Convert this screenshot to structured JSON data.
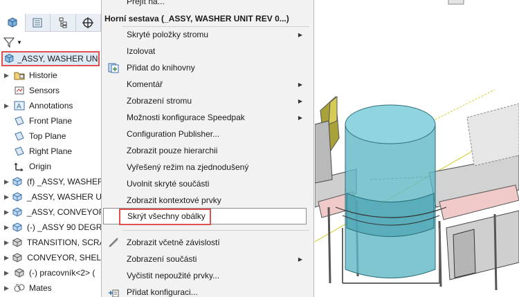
{
  "tree": {
    "root_label": "_ASSY, WASHER UNIT",
    "items": [
      {
        "label": "Historie",
        "icon": "folder-history-icon",
        "expand": true
      },
      {
        "label": "Sensors",
        "icon": "sensor-icon",
        "expand": false
      },
      {
        "label": "Annotations",
        "icon": "annotation-icon",
        "expand": true
      },
      {
        "label": "Front Plane",
        "icon": "plane-icon",
        "expand": false
      },
      {
        "label": "Top Plane",
        "icon": "plane-icon",
        "expand": false
      },
      {
        "label": "Right Plane",
        "icon": "plane-icon",
        "expand": false
      },
      {
        "label": "Origin",
        "icon": "origin-icon",
        "expand": false
      },
      {
        "label": "(f) _ASSY, WASHER",
        "icon": "subassembly-icon",
        "expand": true
      },
      {
        "label": "_ASSY, WASHER U",
        "icon": "subassembly-icon",
        "expand": true
      },
      {
        "label": "_ASSY, CONVEYOR",
        "icon": "subassembly-icon",
        "expand": true
      },
      {
        "label": "(-) _ASSY 90 DEGR",
        "icon": "subassembly-icon",
        "expand": true
      },
      {
        "label": "TRANSITION, SCRA",
        "icon": "part-icon",
        "expand": true
      },
      {
        "label": "CONVEYOR, SHEL",
        "icon": "part-icon",
        "expand": true
      },
      {
        "label": "(-) pracovník<2> (",
        "icon": "part-icon",
        "expand": true
      },
      {
        "label": "Mates",
        "icon": "mates-icon",
        "expand": true
      }
    ]
  },
  "menu": {
    "top_item": "Přejít na...",
    "header": "Horní sestava (_ASSY, WASHER UNIT REV 0...)",
    "group1": [
      {
        "label": "Skryté položky stromu",
        "submenu": true,
        "icon": ""
      },
      {
        "label": "Izolovat",
        "submenu": false,
        "icon": ""
      },
      {
        "label": "Přidat do knihovny",
        "submenu": false,
        "icon": "library-add-icon"
      },
      {
        "label": "Komentář",
        "submenu": true,
        "icon": ""
      },
      {
        "label": "Zobrazení stromu",
        "submenu": true,
        "icon": ""
      },
      {
        "label": "Možnosti konfigurace Speedpak",
        "submenu": true,
        "icon": ""
      },
      {
        "label": "Configuration Publisher...",
        "submenu": false,
        "icon": ""
      },
      {
        "label": "Zobrazit pouze hierarchii",
        "submenu": false,
        "icon": ""
      },
      {
        "label": "Vyřešený režim na zjednodušený",
        "submenu": false,
        "icon": ""
      },
      {
        "label": "Uvolnit skryté součásti",
        "submenu": false,
        "icon": ""
      },
      {
        "label": "Zobrazit kontextové prvky",
        "submenu": false,
        "icon": ""
      },
      {
        "label": "Skrýt všechny obálky",
        "submenu": false,
        "icon": ""
      }
    ],
    "group2": [
      {
        "label": "Zobrazit včetně závislostí",
        "submenu": false,
        "icon": "dependencies-icon"
      },
      {
        "label": "Zobrazení součásti",
        "submenu": true,
        "icon": ""
      },
      {
        "label": "Vyčistit nepoužité prvky...",
        "submenu": false,
        "icon": ""
      },
      {
        "label": "Přidat konfiguraci...",
        "submenu": false,
        "icon": "add-configuration-icon"
      }
    ],
    "highlight_color": "#e0504f"
  }
}
